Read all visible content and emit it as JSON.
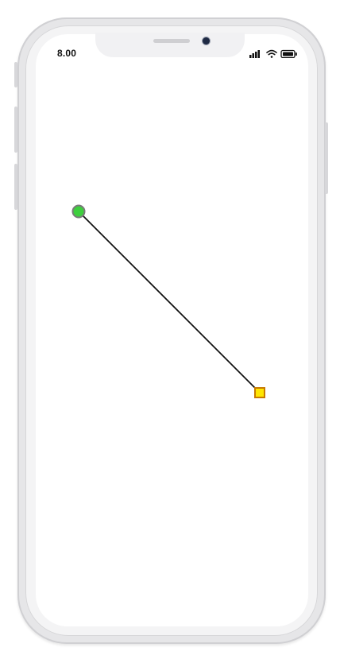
{
  "status_bar": {
    "time": "8.00",
    "icons": [
      "signal-icon",
      "wifi-icon",
      "battery-icon"
    ]
  },
  "diagram": {
    "connector_color": "#111111",
    "start_node": {
      "shape": "circle",
      "fill": "#3ecf3e",
      "stroke": "#7a7a7a"
    },
    "end_node": {
      "shape": "square",
      "fill": "#ffe600",
      "stroke": "#c77a00"
    }
  }
}
